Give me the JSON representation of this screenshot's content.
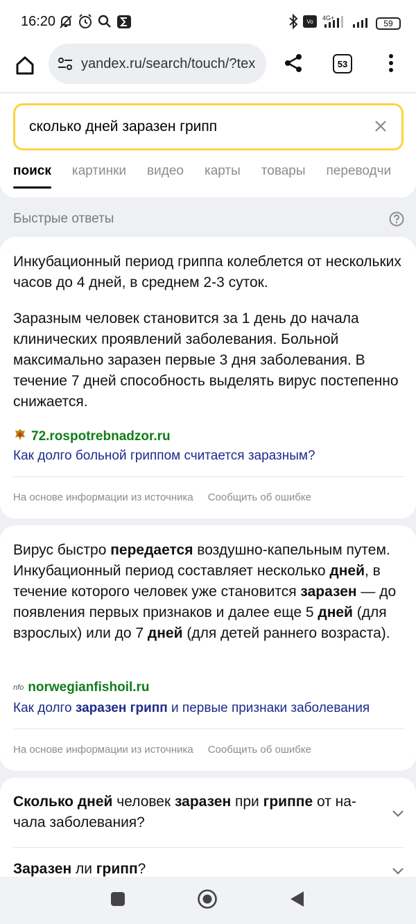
{
  "status_bar": {
    "time": "16:20",
    "left_icons": [
      "muted-bell-icon",
      "alarm-clock-icon",
      "search-icon",
      "sigma-app-icon"
    ],
    "right_icons": [
      "bluetooth-icon",
      "volte-icon",
      "signal-4g-icon",
      "signal-icon"
    ],
    "battery": "59"
  },
  "browser": {
    "url": "yandex.ru/search/touch/?tex",
    "tab_count": "53"
  },
  "search": {
    "query": "сколько дней заразен грипп",
    "tabs": [
      {
        "label": "поиск",
        "active": true
      },
      {
        "label": "картинки"
      },
      {
        "label": "видео"
      },
      {
        "label": "карты"
      },
      {
        "label": "товары"
      },
      {
        "label": "переводчи"
      }
    ]
  },
  "quick_answers": {
    "title": "Быстрые ответы",
    "answer1": {
      "p1": "Инкубационный период гриппа колеблется от нескольких часов до 4 дней, в среднем 2-3 суток.",
      "p2": "Заразным человек становится за 1 день до начала клинических проявлений заболевания. Больной максимально заразен первые 3 дня заболевания. В течение 7 дней способность выделять вирус постепенно снижается.",
      "source_domain": "72.rospotrebnadzor.ru",
      "source_title": "Как долго больной гриппом считается заразным?",
      "footer_info": "На основе информации из источника",
      "footer_report": "Сообщить об ошибке"
    },
    "answer2": {
      "t1": "Вирус быстро ",
      "b1": "передается",
      "t2": " воздушно-капельным путем. Инкубационный период составляет несколько ",
      "b2": "дней",
      "t3": ", в течение которого человек уже становится ",
      "b3": "заразен",
      "t4": " — до появления первых признаков и далее еще 5 ",
      "b4": "дней",
      "t5": " (для взрослых) или до 7 ",
      "b5": "дней",
      "t6": " (для детей раннего возраста).",
      "source_domain": "norwegianfishoil.ru",
      "source_icon_text": "nfo",
      "link_t1": "Как долго ",
      "link_b1": "заразен грипп",
      "link_t2": " и первые признаки заболевания",
      "footer_info": "На основе информации из источника",
      "footer_report": "Сообщить об ошибке"
    }
  },
  "faq": {
    "q1": {
      "b1": "Сколько дней",
      "t1": " человек ",
      "b2": "заразен",
      "t2": " при ",
      "b3": "гриппе",
      "t3": " от на-чала заболевания?"
    },
    "q2": {
      "b1": "Заразен",
      "t1": " ли ",
      "b2": "грипп",
      "t2": "?"
    }
  },
  "colors": {
    "accent_yellow": "#fcd33d",
    "source_green": "#0f7d1a",
    "link_blue": "#1a2b8c"
  }
}
